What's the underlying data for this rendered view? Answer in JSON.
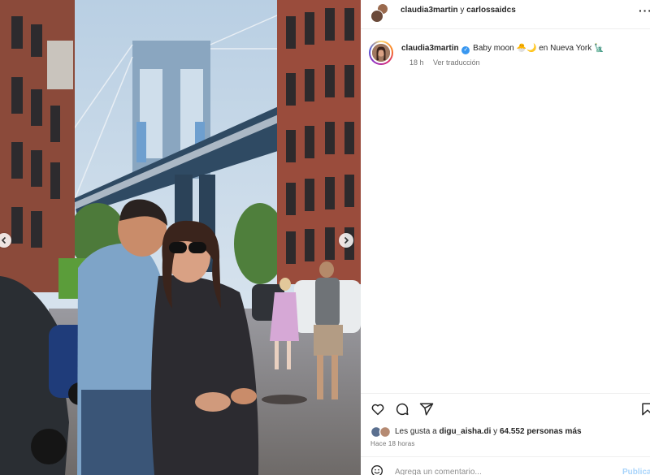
{
  "header": {
    "user_1": "claudia3martin",
    "connector": " y ",
    "user_2": "carlossaidcs",
    "more_icon": "more-horizontal-icon"
  },
  "caption": {
    "username": "claudia3martin",
    "text": "Baby moon 🐣🌙 en Nueva York 🗽",
    "time": "18 h",
    "translate_label": "Ver traducción"
  },
  "actions": {
    "icons": [
      "heart-icon",
      "comment-icon",
      "share-icon",
      "bookmark-icon"
    ]
  },
  "likes": {
    "prefix": "Les gusta a ",
    "user": "digu_aisha.di",
    "middle": " y ",
    "count": "64.552 personas más"
  },
  "time_ago": "Hace 18 horas",
  "comment": {
    "placeholder": "Agrega un comentario...",
    "post_label": "Publicar"
  },
  "colors": {
    "verified": "#3897f0",
    "post_button": "#a8d4fb",
    "muted_text": "#737373"
  }
}
